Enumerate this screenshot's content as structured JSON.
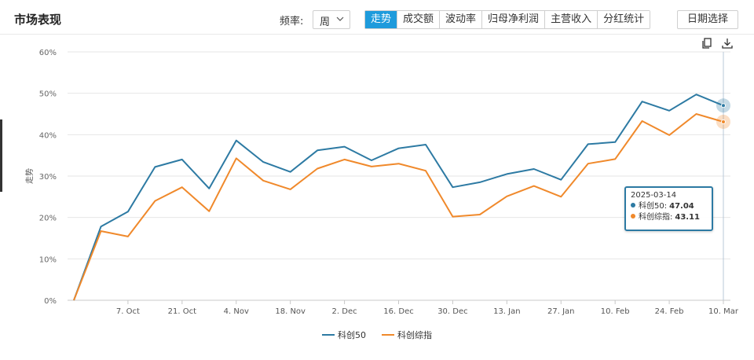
{
  "header": {
    "title": "市场表现",
    "freq_label": "频率:",
    "freq_value": "周",
    "tabs": [
      {
        "label": "走势",
        "active": true
      },
      {
        "label": "成交额",
        "active": false
      },
      {
        "label": "波动率",
        "active": false
      },
      {
        "label": "归母净利润",
        "active": false
      },
      {
        "label": "主营收入",
        "active": false
      },
      {
        "label": "分红统计",
        "active": false
      }
    ],
    "date_button": "日期选择"
  },
  "toolbar": {
    "copy_icon": "copy-icon",
    "download_icon": "download-icon"
  },
  "colors": {
    "series1": "#2d7aa3",
    "series2": "#f0892b",
    "accent": "#1e9bdc"
  },
  "tooltip": {
    "date": "2025-03-14",
    "rows": [
      {
        "name": "科创50",
        "value": "47.04"
      },
      {
        "name": "科创综指",
        "value": "43.11"
      }
    ]
  },
  "chart_data": {
    "type": "line",
    "ylabel": "走势",
    "ylim": [
      0,
      60
    ],
    "yticks": [
      "0%",
      "10%",
      "20%",
      "30%",
      "40%",
      "50%",
      "60%"
    ],
    "x_ticks": [
      "7. Oct",
      "21. Oct",
      "4. Nov",
      "18. Nov",
      "2. Dec",
      "16. Dec",
      "30. Dec",
      "13. Jan",
      "27. Jan",
      "10. Feb",
      "24. Feb",
      "10. Mar"
    ],
    "x": [
      "2024-09-27",
      "2024-10-04",
      "2024-10-18",
      "2024-10-25",
      "2024-11-01",
      "2024-11-08",
      "2024-11-15",
      "2024-11-22",
      "2024-11-29",
      "2024-12-06",
      "2024-12-13",
      "2024-12-20",
      "2024-12-27",
      "2025-01-03",
      "2025-01-10",
      "2025-01-17",
      "2025-01-24",
      "2025-01-31",
      "2025-02-07",
      "2025-02-14",
      "2025-02-21",
      "2025-02-28",
      "2025-03-07",
      "2025-03-14"
    ],
    "grid": true,
    "legend_position": "bottom",
    "series": [
      {
        "name": "科创50",
        "color": "#2d7aa3",
        "values": [
          0,
          17.8,
          21.4,
          32.2,
          34.0,
          27.0,
          38.6,
          33.4,
          31.0,
          36.2,
          37.1,
          33.8,
          36.7,
          37.6,
          27.3,
          28.5,
          30.5,
          31.7,
          29.1,
          37.7,
          38.2,
          48.0,
          45.8,
          49.7,
          47.04
        ]
      },
      {
        "name": "科创综指",
        "color": "#f0892b",
        "values": [
          0,
          16.7,
          15.4,
          24.0,
          27.3,
          21.5,
          34.3,
          28.9,
          26.8,
          31.8,
          34.0,
          32.3,
          33.0,
          31.3,
          20.2,
          20.7,
          25.1,
          27.6,
          25.0,
          33.0,
          34.1,
          43.3,
          39.9,
          45.0,
          43.11
        ]
      }
    ]
  }
}
